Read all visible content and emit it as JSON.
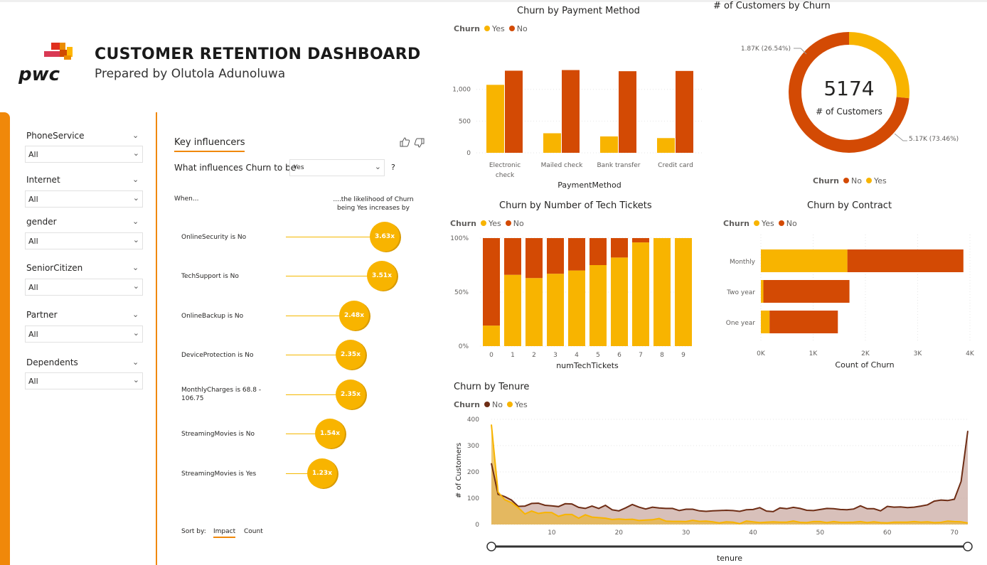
{
  "header": {
    "logo_text": "pwc",
    "title": "CUSTOMER RETENTION DASHBOARD",
    "subtitle": "Prepared by Olutola Adunoluwa"
  },
  "filters": [
    {
      "label": "PhoneService",
      "value": "All"
    },
    {
      "label": "Internet",
      "value": "All"
    },
    {
      "label": "gender",
      "value": "All"
    },
    {
      "label": "SeniorCitizen",
      "value": "All"
    },
    {
      "label": "Partner",
      "value": "All"
    },
    {
      "label": "Dependents",
      "value": "All"
    }
  ],
  "key_influencers": {
    "tab": "Key influencers",
    "question": "What influences Churn to be",
    "selected": "Yes",
    "help": "?",
    "when": "When...",
    "likelihood": "....the likelihood of Churn being Yes increases by",
    "items": [
      {
        "label": "OnlineSecurity is No",
        "value": "3.63x"
      },
      {
        "label": "TechSupport is No",
        "value": "3.51x"
      },
      {
        "label": "OnlineBackup is No",
        "value": "2.48x"
      },
      {
        "label": "DeviceProtection is No",
        "value": "2.35x"
      },
      {
        "label": "MonthlyCharges is 68.8 - 106.75",
        "value": "2.35x"
      },
      {
        "label": "StreamingMovies is No",
        "value": "1.54x"
      },
      {
        "label": "StreamingMovies is Yes",
        "value": "1.23x"
      }
    ],
    "sort_by": "Sort by:",
    "sort_impact": "Impact",
    "sort_count": "Count"
  },
  "colors": {
    "yes": "#f8b400",
    "no": "#d34a04",
    "no_dark": "#6e2d15",
    "accent": "#f0880a"
  },
  "chart_data": [
    {
      "id": "payment",
      "type": "bar",
      "title": "Churn by Payment Method",
      "legend_title": "Churn",
      "xlabel": "PaymentMethod",
      "categories": [
        "Electronic check",
        "Mailed check",
        "Bank transfer",
        "Credit card"
      ],
      "series": [
        {
          "name": "Yes",
          "values": [
            1071,
            308,
            258,
            232
          ]
        },
        {
          "name": "No",
          "values": [
            1294,
            1304,
            1286,
            1290
          ]
        }
      ],
      "yticks": [
        "0",
        "500",
        "1,000"
      ],
      "ylim": [
        0,
        1400
      ]
    },
    {
      "id": "customers",
      "type": "pie",
      "title": "# of Customers by Churn",
      "center_value": "5174",
      "center_label": "# of Customers",
      "legend_title": "Churn",
      "series": [
        {
          "name": "No",
          "value": 73.46,
          "label": "5.17K (73.46%)"
        },
        {
          "name": "Yes",
          "value": 26.54,
          "label": "1.87K (26.54%)"
        }
      ]
    },
    {
      "id": "tickets",
      "type": "bar",
      "title": "Churn by Number of Tech Tickets",
      "legend_title": "Churn",
      "xlabel": "numTechTickets",
      "categories": [
        "0",
        "1",
        "2",
        "3",
        "4",
        "5",
        "6",
        "7",
        "8",
        "9"
      ],
      "series": [
        {
          "name": "Yes",
          "values": [
            19,
            66,
            63,
            67,
            70,
            75,
            82,
            96,
            100,
            100
          ]
        },
        {
          "name": "No",
          "values": [
            81,
            34,
            37,
            33,
            30,
            25,
            18,
            4,
            0,
            0
          ]
        }
      ],
      "yticks": [
        "0%",
        "50%",
        "100%"
      ]
    },
    {
      "id": "contract",
      "type": "bar",
      "title": "Churn by Contract",
      "legend_title": "Churn",
      "xlabel": "Count of Churn",
      "categories": [
        "Monthly",
        "Two year",
        "One year"
      ],
      "series": [
        {
          "name": "Yes",
          "values": [
            1655,
            48,
            166
          ]
        },
        {
          "name": "No",
          "values": [
            2220,
            1647,
            1307
          ]
        }
      ],
      "xticks": [
        "0K",
        "1K",
        "2K",
        "3K",
        "4K"
      ],
      "xlim": [
        0,
        4000
      ]
    },
    {
      "id": "tenure",
      "type": "area",
      "title": "Churn by Tenure",
      "legend_title": "Churn",
      "xlabel": "tenure",
      "ylabel": "# of Customers",
      "x_ticks": [
        "10",
        "20",
        "30",
        "40",
        "50",
        "60",
        "70"
      ],
      "y_ticks": [
        "0",
        "100",
        "200",
        "300",
        "400"
      ],
      "xlim": [
        1,
        72
      ],
      "ylim": [
        0,
        400
      ],
      "series": [
        {
          "name": "No",
          "values": [
            233,
            115,
            106,
            93,
            69,
            70,
            80,
            81,
            73,
            71,
            68,
            79,
            78,
            65,
            61,
            70,
            61,
            73,
            56,
            52,
            63,
            76,
            66,
            59,
            66,
            63,
            61,
            61,
            53,
            58,
            58,
            52,
            50,
            52,
            53,
            54,
            53,
            50,
            56,
            57,
            64,
            51,
            49,
            63,
            60,
            65,
            61,
            54,
            53,
            57,
            61,
            60,
            57,
            56,
            59,
            71,
            60,
            60,
            52,
            69,
            66,
            67,
            64,
            66,
            70,
            75,
            89,
            93,
            91,
            96,
            164,
            356
          ]
        },
        {
          "name": "Yes",
          "values": [
            380,
            123,
            94,
            83,
            64,
            40,
            51,
            42,
            46,
            45,
            31,
            38,
            38,
            24,
            37,
            28,
            26,
            24,
            19,
            21,
            19,
            20,
            15,
            17,
            18,
            23,
            13,
            12,
            12,
            11,
            16,
            12,
            13,
            10,
            6,
            10,
            9,
            3,
            13,
            10,
            7,
            9,
            10,
            9,
            9,
            13,
            8,
            7,
            11,
            11,
            7,
            11,
            8,
            8,
            9,
            11,
            7,
            10,
            7,
            6,
            9,
            9,
            9,
            11,
            9,
            10,
            7,
            8,
            13,
            11,
            10,
            6
          ]
        }
      ]
    }
  ]
}
